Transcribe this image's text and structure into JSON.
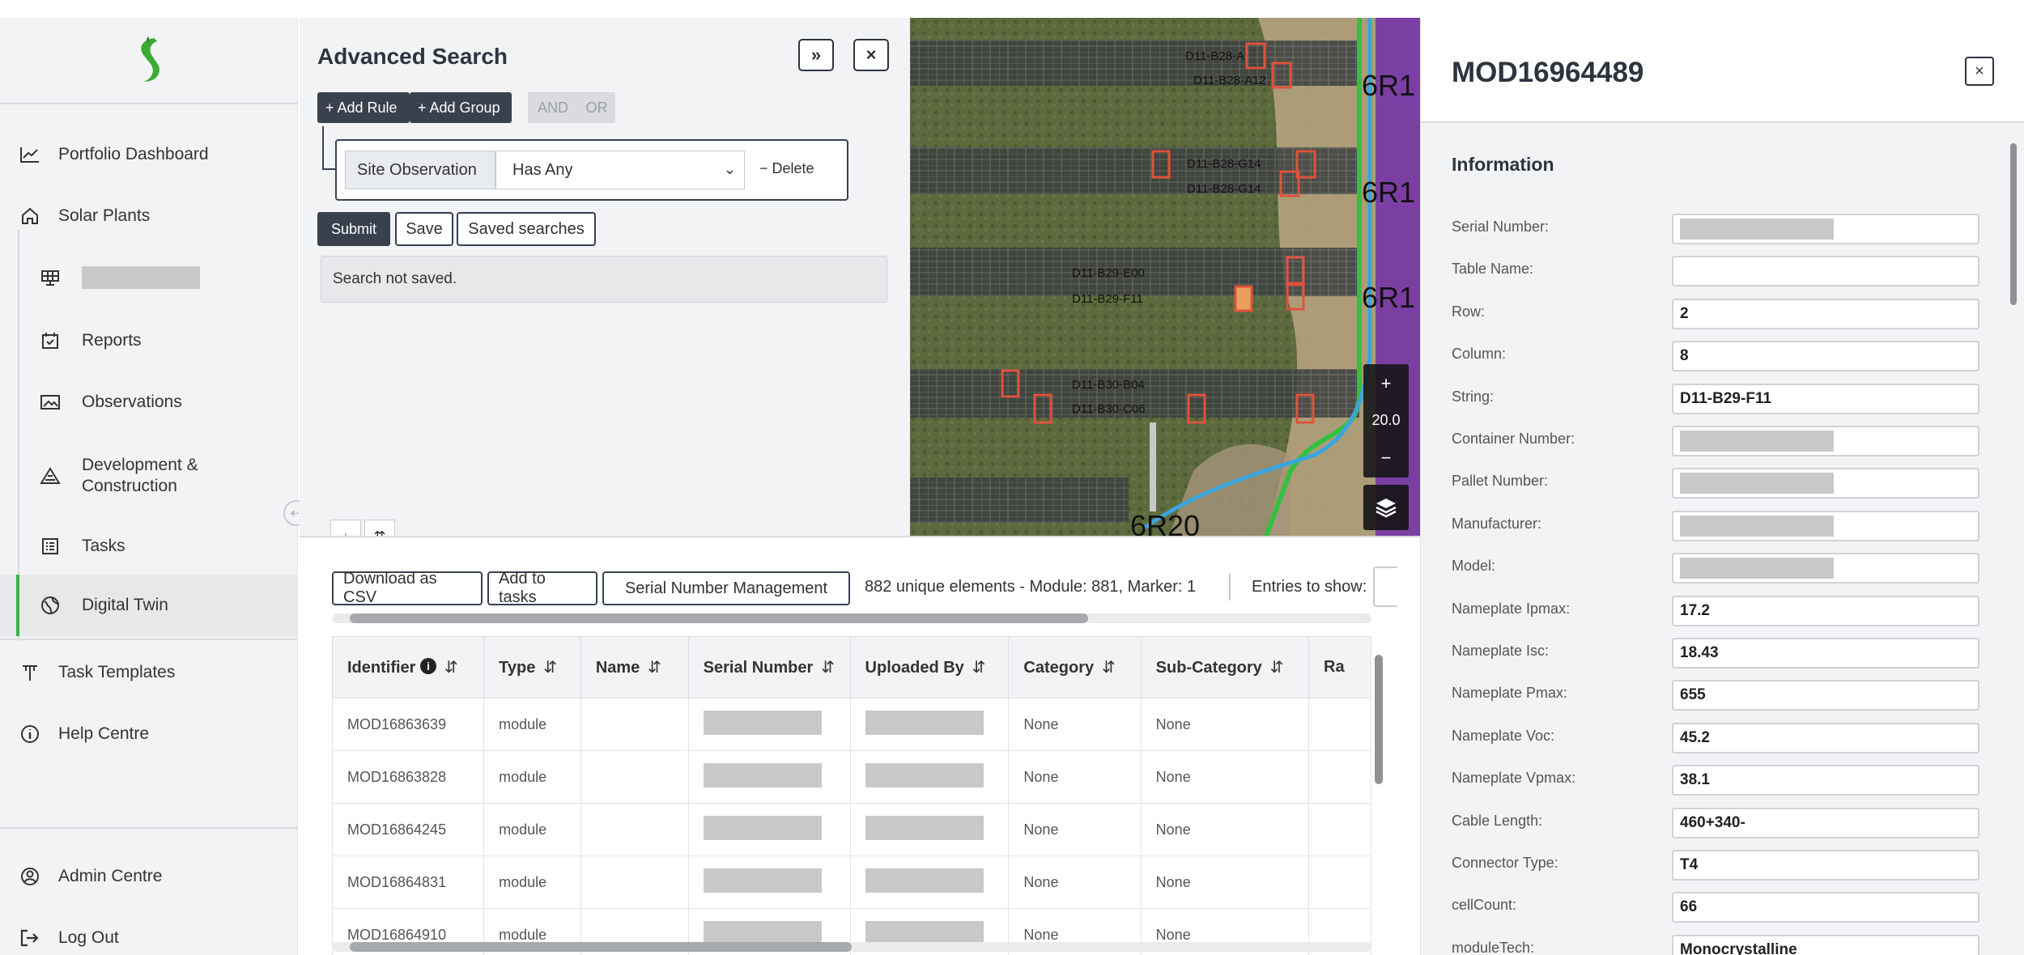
{
  "sidebar": {
    "logo": "S",
    "items": [
      {
        "label": "Portfolio Dashboard",
        "icon": "chart-line-icon"
      },
      {
        "label": "Solar Plants",
        "icon": "home-icon"
      },
      {
        "label": "",
        "icon": "solar-panel-icon",
        "redacted": true
      },
      {
        "label": "Reports",
        "icon": "calendar-check-icon"
      },
      {
        "label": "Observations",
        "icon": "image-icon"
      },
      {
        "label": "Development & Construction",
        "icon": "construction-icon"
      },
      {
        "label": "Tasks",
        "icon": "tasks-list-icon"
      },
      {
        "label": "Digital Twin",
        "icon": "globe-icon",
        "active": true
      },
      {
        "label": "Task Templates",
        "icon": "template-icon"
      },
      {
        "label": "Help Centre",
        "icon": "info-icon"
      },
      {
        "label": "Admin Centre",
        "icon": "user-circle-icon"
      },
      {
        "label": "Log Out",
        "icon": "logout-icon"
      }
    ],
    "active_color": "#39b54a"
  },
  "search": {
    "title": "Advanced Search",
    "expand_label": "»",
    "close_label": "×",
    "add_rule": "+ Add Rule",
    "add_group": "+ Add Group",
    "and_label": "AND",
    "or_label": "OR",
    "rule_field": "Site Observation",
    "rule_operator": "Has Any",
    "delete_label": "− Delete",
    "submit_label": "Submit",
    "save_label": "Save",
    "saved_searches_label": "Saved searches",
    "status": "Search not saved.",
    "tabs": [
      "↓",
      "⇈"
    ]
  },
  "map": {
    "zoom_in": "+",
    "zoom_level": "20.0",
    "zoom_out": "−",
    "labels": [
      "6R1",
      "6R1",
      "6R1",
      "6R20"
    ],
    "string_labels": [
      "D11-B28-A",
      "D11-B28-A12",
      "D11-B28-G14",
      "D11-B28-G14",
      "D11-B29-E00",
      "D11-B29-F11",
      "D11-B30-B04",
      "D11-B30-C06"
    ]
  },
  "table": {
    "download_csv": "Download as CSV",
    "add_to_tasks": "Add to tasks",
    "serial_mgmt": "Serial Number Management",
    "summary": "882 unique elements - Module: 881, Marker: 1",
    "entries_label": "Entries to show:",
    "columns": [
      "Identifier",
      "Type",
      "Name",
      "Serial Number",
      "Uploaded By",
      "Category",
      "Sub-Category",
      "Ra"
    ],
    "rows": [
      {
        "id": "MOD16863639",
        "type": "module",
        "category": "None",
        "subcategory": "None"
      },
      {
        "id": "MOD16863828",
        "type": "module",
        "category": "None",
        "subcategory": "None"
      },
      {
        "id": "MOD16864245",
        "type": "module",
        "category": "None",
        "subcategory": "None"
      },
      {
        "id": "MOD16864831",
        "type": "module",
        "category": "None",
        "subcategory": "None"
      },
      {
        "id": "MOD16864910",
        "type": "module",
        "category": "None",
        "subcategory": "None"
      }
    ]
  },
  "detail": {
    "title": "MOD16964489",
    "close_label": "×",
    "section": "Information",
    "fields": [
      {
        "label": "Serial Number:",
        "value": "",
        "redacted": true
      },
      {
        "label": "Table Name:",
        "value": ""
      },
      {
        "label": "Row:",
        "value": "2"
      },
      {
        "label": "Column:",
        "value": "8"
      },
      {
        "label": "String:",
        "value": "D11-B29-F11"
      },
      {
        "label": "Container Number:",
        "value": "",
        "redacted": true
      },
      {
        "label": "Pallet Number:",
        "value": "",
        "redacted": true
      },
      {
        "label": "Manufacturer:",
        "value": "",
        "redacted": true
      },
      {
        "label": "Model:",
        "value": "",
        "redacted": true
      },
      {
        "label": "Nameplate Ipmax:",
        "value": "17.2"
      },
      {
        "label": "Nameplate Isc:",
        "value": "18.43"
      },
      {
        "label": "Nameplate Pmax:",
        "value": "655"
      },
      {
        "label": "Nameplate Voc:",
        "value": "45.2"
      },
      {
        "label": "Nameplate Vpmax:",
        "value": "38.1"
      },
      {
        "label": "Cable Length:",
        "value": "460+340-"
      },
      {
        "label": "Connector Type:",
        "value": "T4"
      },
      {
        "label": "cellCount:",
        "value": "66"
      },
      {
        "label": "moduleTech:",
        "value": "Monocrystalline"
      }
    ]
  }
}
